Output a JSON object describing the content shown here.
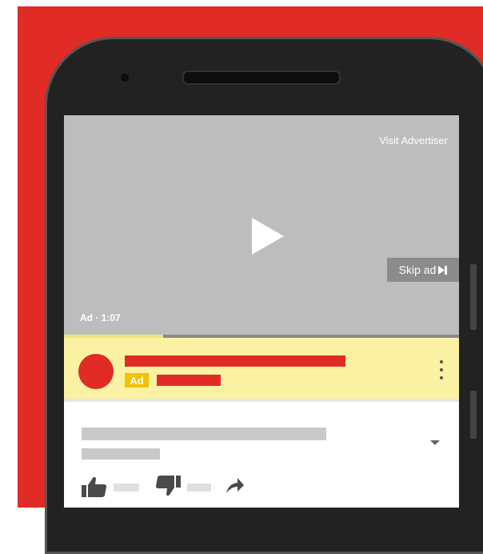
{
  "video": {
    "visit_advertiser": "Visit Advertiser",
    "skip_ad": "Skip ad",
    "ad_time": "Ad · 1:07",
    "progress": 0.25
  },
  "ad_card": {
    "badge": "Ad"
  },
  "colors": {
    "brand_red": "#e02b26",
    "ad_card_bg": "#faf2a2",
    "ad_badge": "#f2c200",
    "video_bg": "#bdbdbd",
    "progress_fill": "#f4e37a"
  },
  "icons": {
    "play": "play-icon",
    "skip": "skip-next-icon",
    "more": "more-vert-icon",
    "expand": "chevron-down-icon",
    "like": "thumbs-up-icon",
    "dislike": "thumbs-down-icon",
    "share": "share-icon"
  }
}
